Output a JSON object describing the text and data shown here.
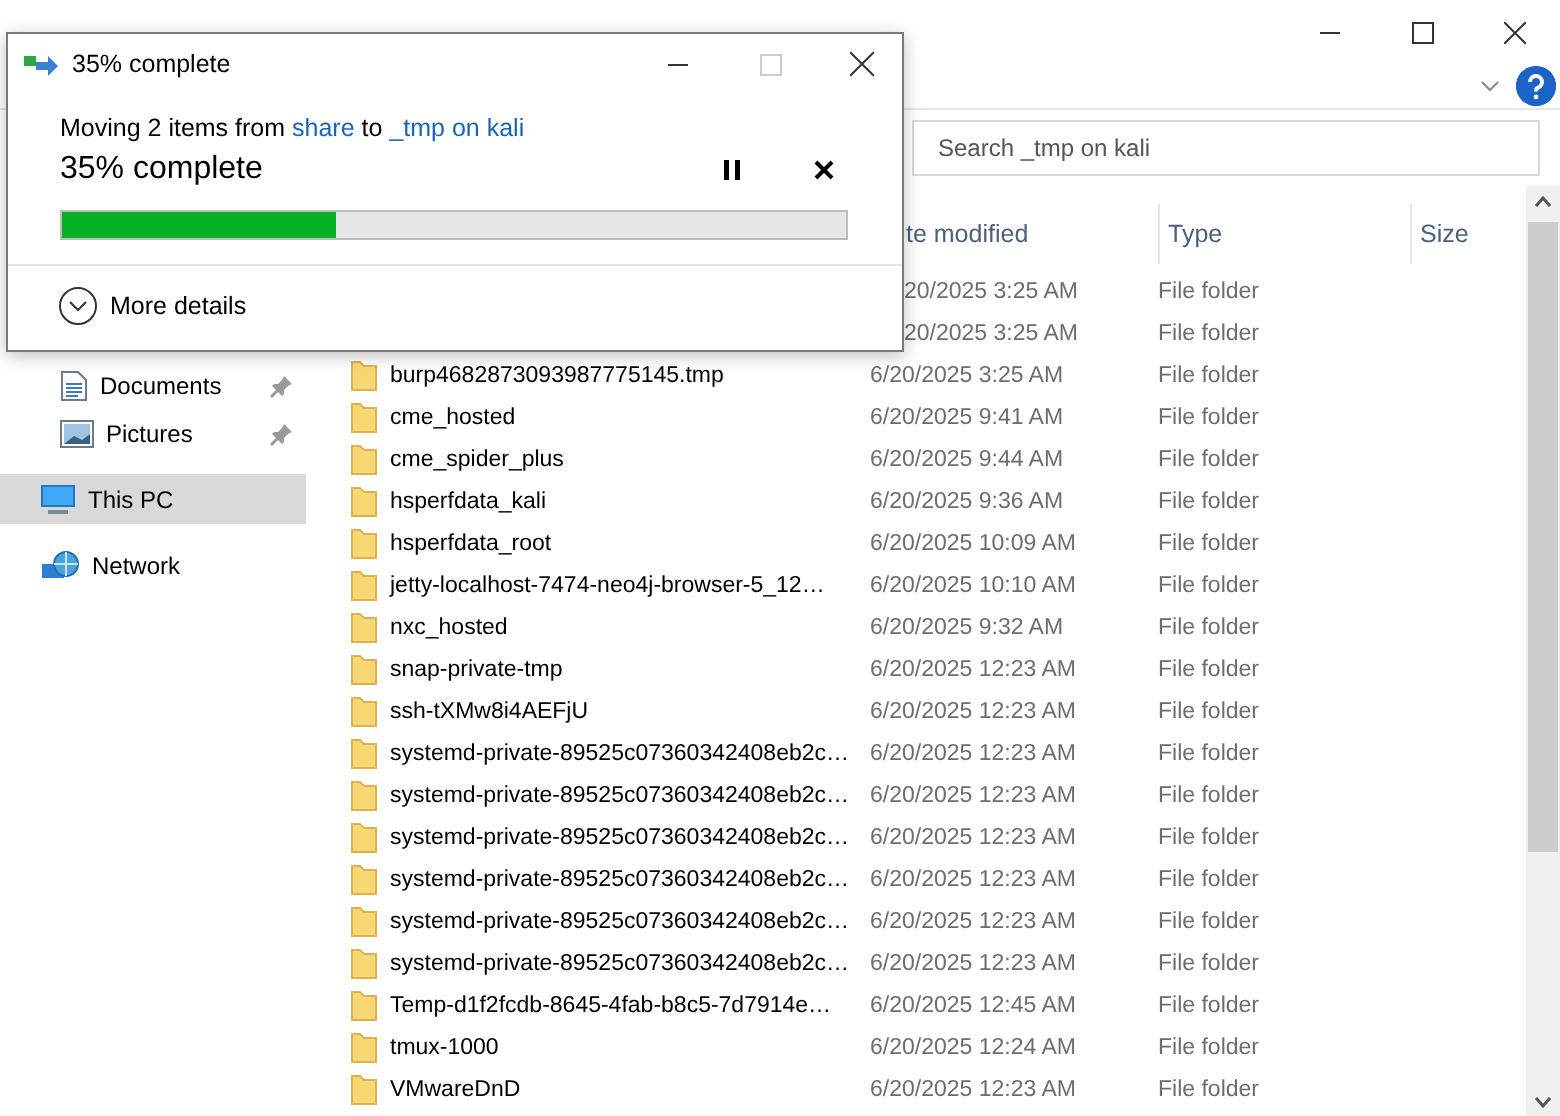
{
  "search": {
    "placeholder": "Search _tmp on kali"
  },
  "nav": [
    {
      "label": "Documents",
      "kind": "documents",
      "pinned": true,
      "selected": false
    },
    {
      "label": "Pictures",
      "kind": "pictures",
      "pinned": true,
      "selected": false
    },
    {
      "label": "This PC",
      "kind": "pc",
      "pinned": false,
      "selected": true
    },
    {
      "label": "Network",
      "kind": "network",
      "pinned": false,
      "selected": false
    }
  ],
  "columns": [
    "te modified",
    "Type",
    "Size"
  ],
  "rows": [
    {
      "date": "20/2025 3:25 AM",
      "type": "File folder"
    },
    {
      "date": "20/2025 3:25 AM",
      "type": "File folder"
    },
    {
      "name": "burp4682873093987775145.tmp",
      "date": "6/20/2025 3:25 AM",
      "type": "File folder"
    },
    {
      "name": "cme_hosted",
      "date": "6/20/2025 9:41 AM",
      "type": "File folder"
    },
    {
      "name": "cme_spider_plus",
      "date": "6/20/2025 9:44 AM",
      "type": "File folder"
    },
    {
      "name": "hsperfdata_kali",
      "date": "6/20/2025 9:36 AM",
      "type": "File folder"
    },
    {
      "name": "hsperfdata_root",
      "date": "6/20/2025 10:09 AM",
      "type": "File folder"
    },
    {
      "name": "jetty-localhost-7474-neo4j-browser-5_12…",
      "date": "6/20/2025 10:10 AM",
      "type": "File folder"
    },
    {
      "name": "nxc_hosted",
      "date": "6/20/2025 9:32 AM",
      "type": "File folder"
    },
    {
      "name": "snap-private-tmp",
      "date": "6/20/2025 12:23 AM",
      "type": "File folder"
    },
    {
      "name": "ssh-tXMw8i4AEFjU",
      "date": "6/20/2025 12:23 AM",
      "type": "File folder"
    },
    {
      "name": "systemd-private-89525c07360342408eb2c…",
      "date": "6/20/2025 12:23 AM",
      "type": "File folder"
    },
    {
      "name": "systemd-private-89525c07360342408eb2c…",
      "date": "6/20/2025 12:23 AM",
      "type": "File folder"
    },
    {
      "name": "systemd-private-89525c07360342408eb2c…",
      "date": "6/20/2025 12:23 AM",
      "type": "File folder"
    },
    {
      "name": "systemd-private-89525c07360342408eb2c…",
      "date": "6/20/2025 12:23 AM",
      "type": "File folder"
    },
    {
      "name": "systemd-private-89525c07360342408eb2c…",
      "date": "6/20/2025 12:23 AM",
      "type": "File folder"
    },
    {
      "name": "systemd-private-89525c07360342408eb2c…",
      "date": "6/20/2025 12:23 AM",
      "type": "File folder"
    },
    {
      "name": "Temp-d1f2fcdb-8645-4fab-b8c5-7d7914e…",
      "date": "6/20/2025 12:45 AM",
      "type": "File folder"
    },
    {
      "name": "tmux-1000",
      "date": "6/20/2025 12:24 AM",
      "type": "File folder"
    },
    {
      "name": "VMwareDnD",
      "date": "6/20/2025 12:23 AM",
      "type": "File folder"
    }
  ],
  "dialog": {
    "title": "35% complete",
    "message": {
      "prefix": "Moving 2 items from",
      "source": "share",
      "middle": "to",
      "destination": "_tmp on kali"
    },
    "status": "35% complete",
    "level": 0.35,
    "details": "More details"
  }
}
